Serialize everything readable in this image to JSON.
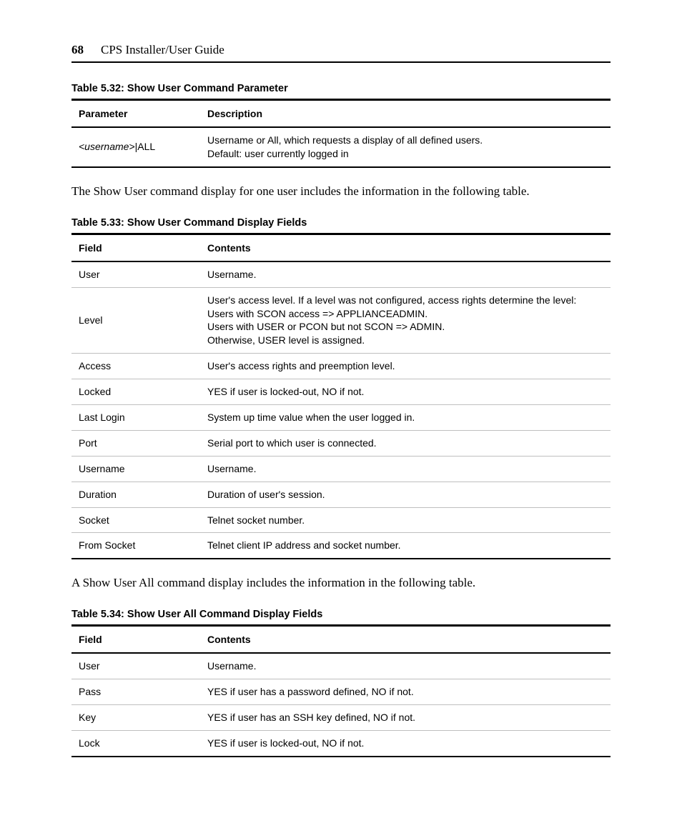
{
  "header": {
    "page_number": "68",
    "title": "CPS Installer/User Guide"
  },
  "table32": {
    "caption": "Table 5.32: Show User Command Parameter",
    "head": {
      "c1": "Parameter",
      "c2": "Description"
    },
    "rows": [
      {
        "param_italic": "<username>",
        "param_suffix": "|ALL",
        "desc": "Username or All, which requests a display of all defined users.\nDefault: user currently logged in"
      }
    ]
  },
  "para1": "The Show User command display for one user includes the information in the following table.",
  "table33": {
    "caption": "Table 5.33: Show User Command Display Fields",
    "head": {
      "c1": "Field",
      "c2": "Contents"
    },
    "rows": [
      {
        "field": "User",
        "contents": "Username."
      },
      {
        "field": "Level",
        "contents": "User's access level. If a level was not configured, access rights determine the level:\nUsers with SCON access => APPLIANCEADMIN.\nUsers with USER or PCON but not SCON => ADMIN.\nOtherwise, USER level is assigned."
      },
      {
        "field": "Access",
        "contents": "User's access rights and preemption level."
      },
      {
        "field": "Locked",
        "contents": "YES if user is locked-out, NO if not."
      },
      {
        "field": "Last Login",
        "contents": "System up time value when the user logged in."
      },
      {
        "field": "Port",
        "contents": "Serial port to which user is connected."
      },
      {
        "field": "Username",
        "contents": "Username."
      },
      {
        "field": "Duration",
        "contents": "Duration of user's session."
      },
      {
        "field": "Socket",
        "contents": "Telnet socket number."
      },
      {
        "field": "From Socket",
        "contents": "Telnet client IP address and socket number."
      }
    ]
  },
  "para2": "A Show User All command display includes the information in the following table.",
  "table34": {
    "caption": "Table 5.34: Show User All Command Display Fields",
    "head": {
      "c1": "Field",
      "c2": "Contents"
    },
    "rows": [
      {
        "field": "User",
        "contents": "Username."
      },
      {
        "field": "Pass",
        "contents": "YES if user has a password defined, NO if not."
      },
      {
        "field": "Key",
        "contents": "YES if user has an SSH key defined, NO if not."
      },
      {
        "field": "Lock",
        "contents": "YES if user is locked-out, NO if not."
      }
    ]
  }
}
